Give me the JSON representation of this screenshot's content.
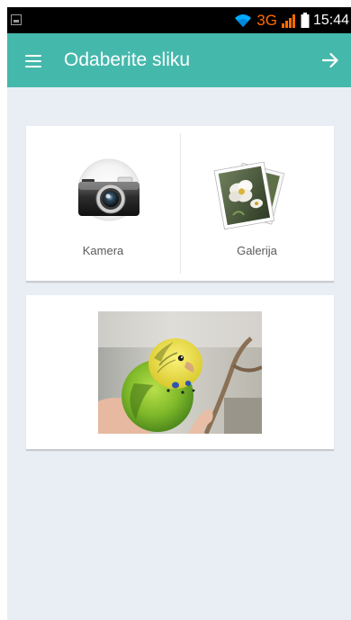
{
  "status_bar": {
    "network_type": "3G",
    "time": "15:44",
    "icons": [
      "notification-image-icon",
      "wifi-icon",
      "signal-icon",
      "battery-icon"
    ]
  },
  "app_bar": {
    "title": "Odaberite sliku",
    "menu_icon": "menu-icon",
    "forward_icon": "arrow-forward-icon",
    "background": "#45b8ac"
  },
  "source_options": [
    {
      "label": "Kamera",
      "icon": "camera-icon"
    },
    {
      "label": "Galerija",
      "icon": "gallery-icon"
    }
  ],
  "preview": {
    "image": "budgerigar-photo"
  },
  "colors": {
    "accent": "#45b8ac",
    "background": "#e9edf4",
    "network_type": "#ff6a00"
  }
}
